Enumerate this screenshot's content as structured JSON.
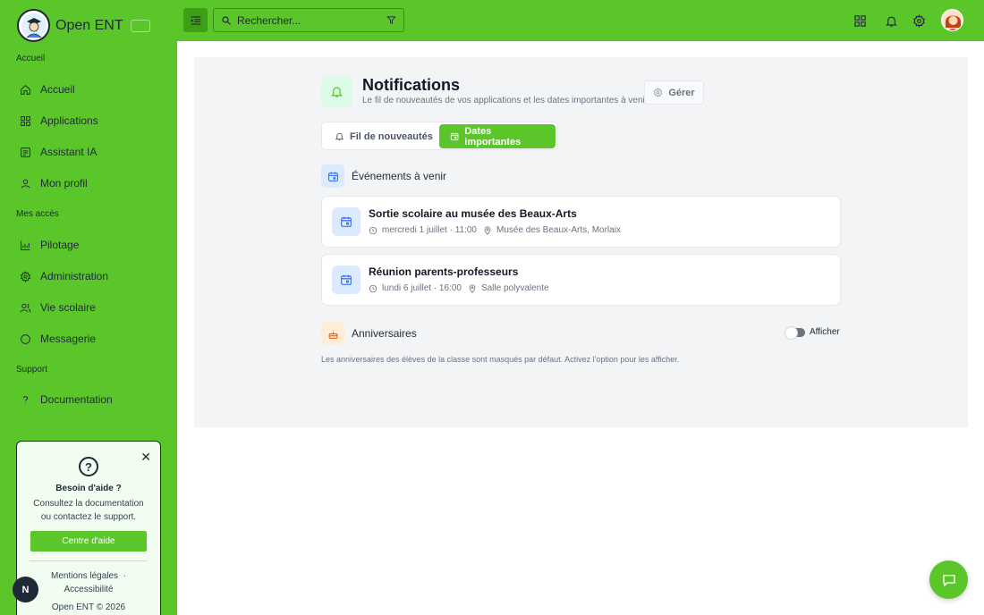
{
  "brand": {
    "name": "Open ENT"
  },
  "sidebar": {
    "sections": [
      {
        "label": "Accueil"
      },
      {
        "label": "Mes accès"
      },
      {
        "label": "Support"
      }
    ],
    "items": [
      {
        "label": "Accueil",
        "icon": "home-icon"
      },
      {
        "label": "Applications",
        "icon": "grid-icon"
      },
      {
        "label": "Assistant IA",
        "icon": "assistant-icon"
      },
      {
        "label": "Mon profil",
        "icon": "user-icon"
      },
      {
        "label": "Pilotage",
        "icon": "chart-icon"
      },
      {
        "label": "Administration",
        "icon": "gear-icon"
      },
      {
        "label": "Vie scolaire",
        "icon": "users-icon"
      },
      {
        "label": "Messagerie",
        "icon": "message-icon"
      },
      {
        "label": "Documentation",
        "icon": "question-icon"
      }
    ]
  },
  "help": {
    "title": "Besoin d'aide ?",
    "text_line1": "Consultez la documentation",
    "text_line2": "ou contactez le support.",
    "button": "Centre d'aide",
    "link_legal": "Mentions légales",
    "link_separator": "·",
    "link_access": "Accessibilité",
    "copyright": "Open ENT © 2026"
  },
  "badge": {
    "letter": "N"
  },
  "topbar": {
    "search_placeholder": "Rechercher..."
  },
  "notifications": {
    "title": "Notifications",
    "subtitle": "Le fil de nouveautés de vos applications et les dates importantes à venir.",
    "manage": "Gérer",
    "tabs": [
      {
        "label": "Fil de nouveautés",
        "active": false
      },
      {
        "label": "Dates importantes",
        "active": true
      }
    ],
    "upcoming_title": "Événements à venir",
    "events": [
      {
        "title": "Sortie scolaire au musée des Beaux-Arts",
        "date": "mercredi 1 juillet · 11:00",
        "location": "Musée des Beaux-Arts, Morlaix"
      },
      {
        "title": "Réunion parents-professeurs",
        "date": "lundi 6 juillet · 16:00",
        "location": "Salle polyvalente"
      }
    ],
    "birthdays_title": "Anniversaires",
    "toggle_label": "Afficher",
    "birthdays_note": "Les anniversaires des élèves de la classe sont masqués par défaut. Activez l'option pour les afficher."
  },
  "colors": {
    "primary": "#5bc62a",
    "primary_dark": "#3f9e17",
    "event_icon_bg": "#dbeafe",
    "birthday_icon_bg": "#ffedd5"
  }
}
